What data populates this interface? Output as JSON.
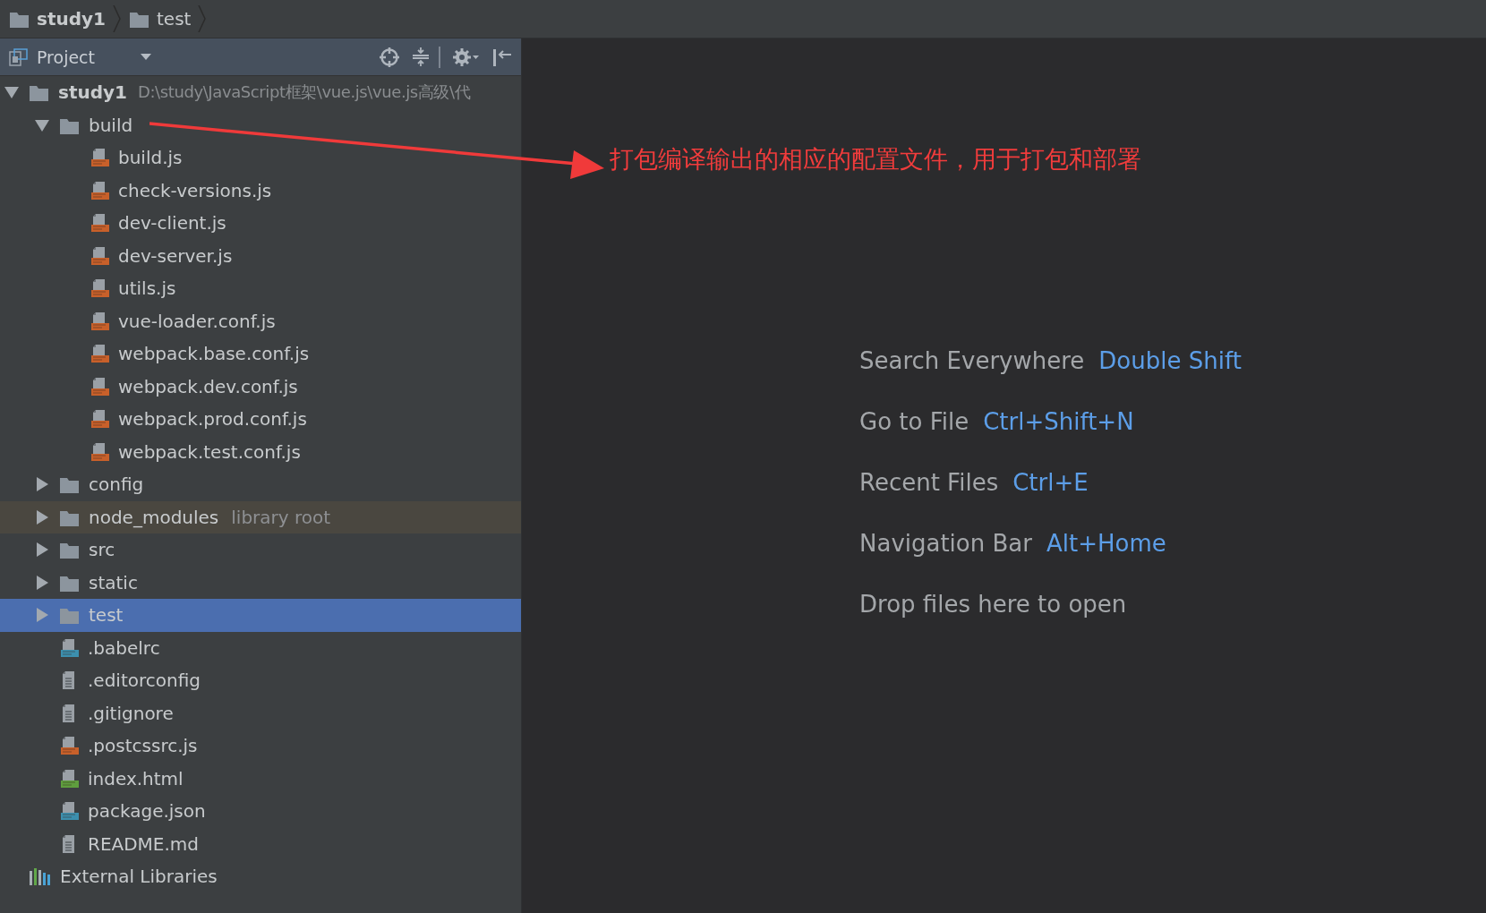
{
  "breadcrumbs": [
    {
      "label": "study1",
      "bold": true
    },
    {
      "label": "test",
      "bold": false
    }
  ],
  "panel": {
    "title": "Project"
  },
  "tree": [
    {
      "kind": "folder",
      "name": "study1",
      "bold": true,
      "path": "D:\\study\\JavaScript框架\\vue.js\\vue.js高级\\代",
      "expanded": true,
      "selected": false,
      "highlighted": false,
      "children": [
        {
          "kind": "folder",
          "name": "build",
          "expanded": true,
          "selected": false,
          "highlighted": false,
          "children": [
            {
              "kind": "js",
              "name": "build.js",
              "selected": false,
              "highlighted": false
            },
            {
              "kind": "js",
              "name": "check-versions.js",
              "selected": false,
              "highlighted": false
            },
            {
              "kind": "js",
              "name": "dev-client.js",
              "selected": false,
              "highlighted": false
            },
            {
              "kind": "js",
              "name": "dev-server.js",
              "selected": false,
              "highlighted": false
            },
            {
              "kind": "js",
              "name": "utils.js",
              "selected": false,
              "highlighted": false
            },
            {
              "kind": "js",
              "name": "vue-loader.conf.js",
              "selected": false,
              "highlighted": false
            },
            {
              "kind": "js",
              "name": "webpack.base.conf.js",
              "selected": false,
              "highlighted": false
            },
            {
              "kind": "js",
              "name": "webpack.dev.conf.js",
              "selected": false,
              "highlighted": false
            },
            {
              "kind": "js",
              "name": "webpack.prod.conf.js",
              "selected": false,
              "highlighted": false
            },
            {
              "kind": "js",
              "name": "webpack.test.conf.js",
              "selected": false,
              "highlighted": false
            }
          ]
        },
        {
          "kind": "folder",
          "name": "config",
          "expanded": false,
          "selected": false,
          "highlighted": false
        },
        {
          "kind": "folder",
          "name": "node_modules",
          "note": "library root",
          "expanded": false,
          "selected": false,
          "highlighted": true
        },
        {
          "kind": "folder",
          "name": "src",
          "expanded": false,
          "selected": false,
          "highlighted": false
        },
        {
          "kind": "folder",
          "name": "static",
          "expanded": false,
          "selected": false,
          "highlighted": false
        },
        {
          "kind": "folder",
          "name": "test",
          "expanded": false,
          "selected": true,
          "highlighted": false
        },
        {
          "kind": "json",
          "name": ".babelrc",
          "selected": false,
          "highlighted": false
        },
        {
          "kind": "text",
          "name": ".editorconfig",
          "selected": false,
          "highlighted": false
        },
        {
          "kind": "text",
          "name": ".gitignore",
          "selected": false,
          "highlighted": false
        },
        {
          "kind": "js",
          "name": ".postcssrc.js",
          "selected": false,
          "highlighted": false
        },
        {
          "kind": "html",
          "name": "index.html",
          "selected": false,
          "highlighted": false
        },
        {
          "kind": "json",
          "name": "package.json",
          "selected": false,
          "highlighted": false
        },
        {
          "kind": "text",
          "name": "README.md",
          "selected": false,
          "highlighted": false
        }
      ]
    },
    {
      "kind": "libraries",
      "name": "External Libraries",
      "selected": false,
      "highlighted": false
    }
  ],
  "hints": [
    {
      "action": "Search Everywhere",
      "shortcut": "Double Shift"
    },
    {
      "action": "Go to File",
      "shortcut": "Ctrl+Shift+N"
    },
    {
      "action": "Recent Files",
      "shortcut": "Ctrl+E"
    },
    {
      "action": "Navigation Bar",
      "shortcut": "Alt+Home"
    },
    {
      "action": "Drop files here to open"
    }
  ],
  "annotation": {
    "text": "打包编译输出的相应的配置文件，用于打包和部署"
  }
}
